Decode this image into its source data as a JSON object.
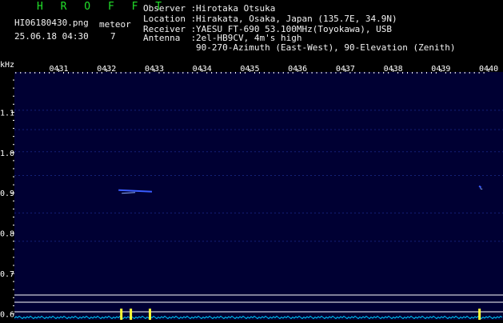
{
  "header": {
    "brand": "H R O F F T",
    "filename": "HI06180430.png",
    "datetime": "25.06.18 04:30",
    "meteor_label": "meteor",
    "meteor_count": "7"
  },
  "info": {
    "observer_key": "Observer :",
    "observer": "Hirotaka Otsuka",
    "location_key": "Location :",
    "location": "Hirakata, Osaka, Japan (135.7E, 34.9N)",
    "receiver_key": "Receiver :",
    "receiver": "YAESU FT-690 53.100MHz(Toyokawa), USB",
    "antenna_key": "Antenna  :",
    "antenna_line1": "2el-HB9CV, 4m's high",
    "antenna_line2": "90-270-Azimuth (East-West), 90-Elevation (Zenith)"
  },
  "colors": {
    "green_text": "#22e02a",
    "white_text": "#f2f2f2",
    "background": "#000000",
    "plot_background": "#000033",
    "tick_color": "#ffffff",
    "meteor_echo": "#3a5cff",
    "spectrum": "#00ccff",
    "spectrum_peak": "#ffff33"
  },
  "chart_data": {
    "type": "heatmap",
    "y_unit": "kHz",
    "x_ticks": [
      "0431",
      "0432",
      "0433",
      "0434",
      "0435",
      "0436",
      "0437",
      "0438",
      "0439",
      "0440"
    ],
    "x_tick_minutes": [
      31,
      32,
      33,
      34,
      35,
      36,
      37,
      38,
      39,
      40
    ],
    "xlim": [
      30.07,
      40.3
    ],
    "y_ticks": [
      "1.1",
      "1.0",
      "0.9",
      "0.8",
      "0.7",
      "0.6"
    ],
    "y_tick_values": [
      1.1,
      1.0,
      0.9,
      0.8,
      0.7,
      0.6
    ],
    "ylim": [
      0.585,
      1.2
    ],
    "noise_lines_khz": [
      1.105,
      1.057,
      1.002,
      0.943,
      0.85,
      0.78
    ],
    "echoes": [
      {
        "minute_start": 32.25,
        "minute_end": 32.95,
        "freq_khz": 0.903
      },
      {
        "minute_start": 39.8,
        "minute_end": 39.84,
        "freq_khz": 0.913
      }
    ],
    "spectrum_peaks_minute": [
      32.3,
      32.5,
      32.9,
      39.8
    ]
  }
}
